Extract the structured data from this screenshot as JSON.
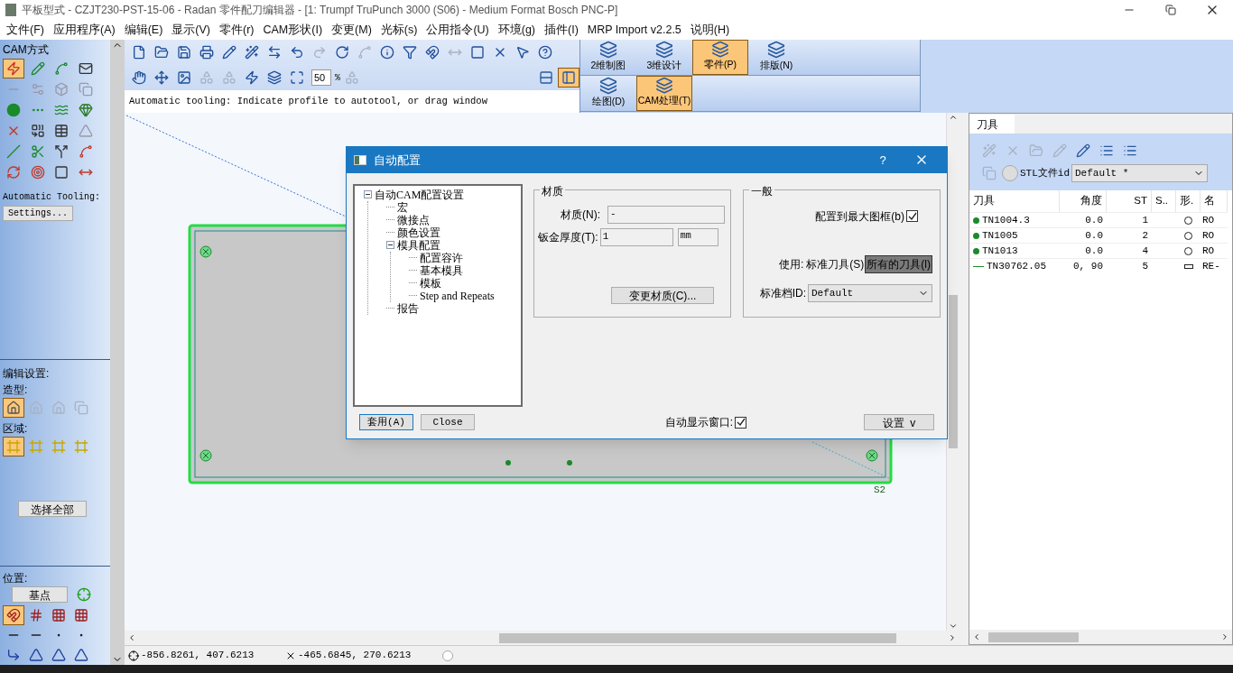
{
  "window": {
    "title": "平板型式 - CZJT230-PST-15-06 - Radan 零件配刀编辑器 - [1: Trumpf TruPunch 3000 (S06) - Medium Format Bosch PNC-P]"
  },
  "menu": [
    "文件(F)",
    "应用程序(A)",
    "编辑(E)",
    "显示(V)",
    "零件(r)",
    "CAM形状(I)",
    "变更(M)",
    "光标(s)",
    "公用指令(U)",
    "环境(g)",
    "插件(I)",
    "MRP Import v2.2.5",
    "说明(H)"
  ],
  "cam_panel": {
    "title": "CAM方式",
    "tools": [
      {
        "selected": true
      },
      {
        "selected": false
      },
      {
        "selected": false
      },
      {
        "selected": false
      },
      {
        "selected": false
      },
      {
        "selected": false
      },
      {
        "selected": false
      },
      {
        "selected": false
      },
      {
        "selected": false
      },
      {
        "selected": false
      },
      {
        "selected": false
      },
      {
        "selected": false
      },
      {
        "selected": false
      },
      {
        "selected": false
      },
      {
        "selected": false
      },
      {
        "selected": false
      },
      {
        "selected": false
      },
      {
        "selected": false
      },
      {
        "selected": false
      },
      {
        "selected": false
      },
      {
        "selected": false
      },
      {
        "selected": false
      },
      {
        "selected": false
      },
      {
        "selected": false
      }
    ],
    "auto_tooling_label": "Automatic Tooling:",
    "settings_button": "Settings..."
  },
  "edit_panel": {
    "title": "编辑设置:",
    "shape_label": "造型:",
    "shape_tools": [
      {
        "selected": true
      },
      {
        "selected": false
      },
      {
        "selected": false
      },
      {
        "selected": false
      }
    ],
    "region_label": "区域:",
    "region_tools": [
      {
        "selected": true
      },
      {
        "selected": false
      },
      {
        "selected": false
      },
      {
        "selected": false
      }
    ],
    "select_all_button": "选择全部"
  },
  "position_panel": {
    "title": "位置:",
    "base_point_button": "基点",
    "snap_tools": [
      {
        "selected": true
      },
      {
        "selected": false
      },
      {
        "selected": false
      },
      {
        "selected": false
      }
    ]
  },
  "toolbar": {
    "zoom": "50",
    "zoom_unit": "%",
    "layout_toggles": [
      {
        "selected": false
      },
      {
        "selected": true
      }
    ]
  },
  "hint": "Automatic tooling: Indicate profile to autotool, or drag window",
  "mode_rows": [
    {
      "buttons": [
        {
          "label": "2维制图",
          "selected": false
        },
        {
          "label": "3维设计",
          "selected": false
        },
        {
          "label": "零件(P)",
          "selected": true
        },
        {
          "label": "排版(N)",
          "selected": false
        }
      ]
    },
    {
      "buttons": [
        {
          "label": "绘图(D)",
          "selected": false
        },
        {
          "label": "CAM处理(T)",
          "selected": true
        }
      ]
    }
  ],
  "canvas": {
    "label": "S2"
  },
  "dialog": {
    "title": "自动配置",
    "help": "?",
    "tree": [
      {
        "label": "自动CAM配置设置",
        "expanded": true,
        "children": [
          {
            "label": "宏"
          },
          {
            "label": "微接点"
          },
          {
            "label": "颜色设置"
          },
          {
            "label": "模具配置",
            "expanded": true,
            "children": [
              {
                "label": "配置容许"
              },
              {
                "label": "基本模具"
              },
              {
                "label": "模板"
              },
              {
                "label": "Step and Repeats"
              }
            ]
          },
          {
            "label": "报告"
          }
        ]
      }
    ],
    "material": {
      "title": "材质",
      "material_label": "材质(N):",
      "material": "-",
      "thickness_label": "钣金厚度(T):",
      "thickness": "1",
      "unit": "mm",
      "change_button": "变更材质(C)..."
    },
    "general": {
      "title": "一般",
      "fit_label": "配置到最大图框(b)",
      "fit_checked": true,
      "use_label": "使用:",
      "use_options": [
        {
          "label": "标准刀具(S)",
          "selected": false
        },
        {
          "label": "所有的刀具(l)",
          "selected": true
        }
      ],
      "std_id_label": "标准档ID:",
      "std_id": "Default"
    },
    "apply_button": "套用(A)",
    "close_button": "Close",
    "auto_show_label": "自动显示窗口:",
    "auto_show_checked": true,
    "settings_button": "设置  v"
  },
  "tool_panel": {
    "tabs": [
      {
        "label": "刀具",
        "selected": true
      }
    ],
    "stl_label": "STL文件id",
    "stl_value": "Default *",
    "columns": [
      "刀具",
      "角度",
      "ST",
      "S..",
      "形.",
      "名"
    ],
    "rows": [
      {
        "name": "TN1004.3",
        "angle": "0.0",
        "st": "1",
        "kind": "round",
        "column_6": "RO"
      },
      {
        "name": "TN1005",
        "angle": "0.0",
        "st": "2",
        "kind": "round",
        "column_6": "RO"
      },
      {
        "name": "TN1013",
        "angle": "0.0",
        "st": "4",
        "kind": "round",
        "column_6": "RO"
      },
      {
        "name": "TN30762.05",
        "angle": "0, 90",
        "st": "5",
        "kind": "rectangle",
        "column_6": "RE-"
      }
    ]
  },
  "status_bar": {
    "cursor": "-856.8261, 407.6213",
    "reference": "-465.6845, 270.6213"
  }
}
